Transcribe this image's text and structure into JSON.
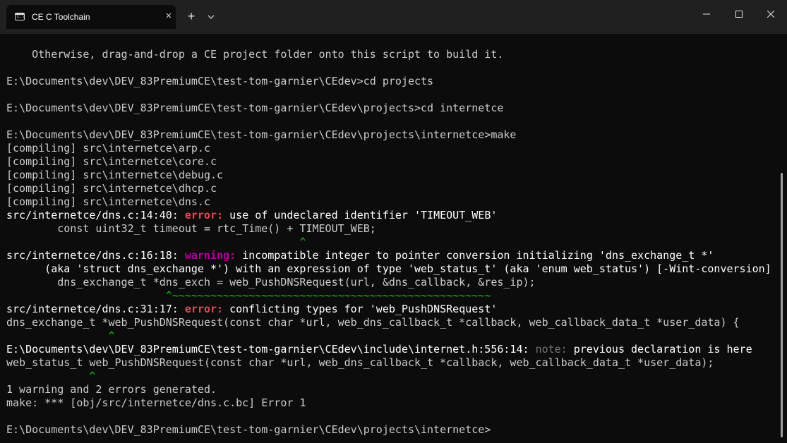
{
  "window": {
    "tab_title": "CE C Toolchain",
    "close_tab_glyph": "×",
    "new_tab_glyph": "+",
    "icons": [
      "terminal-icon",
      "close-icon",
      "plus-icon",
      "chevron-down-icon",
      "minimize-icon",
      "maximize-icon",
      "window-close-icon"
    ]
  },
  "colors": {
    "background": "#0c0c0c",
    "titlebar": "#202020",
    "text": "#cccccc",
    "error": "#e74856",
    "warning": "#b4009e",
    "note": "#767676",
    "caret": "#16c60c"
  },
  "terminal": {
    "l1": "    Otherwise, drag-and-drop a CE project folder onto this script to build it.",
    "l2": "E:\\Documents\\dev\\DEV_83PremiumCE\\test-tom-garnier\\CEdev>cd projects",
    "l3": "E:\\Documents\\dev\\DEV_83PremiumCE\\test-tom-garnier\\CEdev\\projects>cd internetce",
    "l4": "E:\\Documents\\dev\\DEV_83PremiumCE\\test-tom-garnier\\CEdev\\projects\\internetce>make",
    "c1": "[compiling] src\\internetce\\arp.c",
    "c2": "[compiling] src\\internetce\\core.c",
    "c3": "[compiling] src\\internetce\\debug.c",
    "c4": "[compiling] src\\internetce\\dhcp.c",
    "c5": "[compiling] src\\internetce\\dns.c",
    "e1_loc": "src/internetce/dns.c:14:40: ",
    "e1_kind": "error:",
    "e1_msg": " use of undeclared identifier 'TIMEOUT_WEB'",
    "e1_code": "        const uint32_t timeout = rtc_Time() + TIMEOUT_WEB;",
    "e1_caret": "                                              ^",
    "w1_loc": "src/internetce/dns.c:16:18: ",
    "w1_kind": "warning:",
    "w1_msg": " incompatible integer to pointer conversion initializing 'dns_exchange_t *'",
    "w1_msg2": "      (aka 'struct dns_exchange *') with an expression of type 'web_status_t' (aka 'enum web_status') [-Wint-conversion]",
    "w1_code": "        dns_exchange_t *dns_exch = web_PushDNSRequest(url, &dns_callback, &res_ip);",
    "w1_caret_pos": "                         ^",
    "w1_caret_tilde": "~~~~~~~~~~~~~~~~~~~~~~~~~~~~~~~~~~~~~~~~~~~~~~~~~~",
    "e2_loc": "src/internetce/dns.c:31:17: ",
    "e2_kind": "error:",
    "e2_msg": " conflicting types for 'web_PushDNSRequest'",
    "e2_code": "dns_exchange_t *web_PushDNSRequest(const char *url, web_dns_callback_t *callback, web_callback_data_t *user_data) {",
    "e2_caret": "                ^",
    "n1_loc": "E:\\Documents\\dev\\DEV_83PremiumCE\\test-tom-garnier\\CEdev\\include\\internet.h:556:14: ",
    "n1_kind": "note:",
    "n1_msg": " previous declaration is here",
    "n1_code": "web_status_t web_PushDNSRequest(const char *url, web_dns_callback_t *callback, web_callback_data_t *user_data);",
    "n1_caret": "             ^",
    "summary": "1 warning and 2 errors generated.",
    "make_err": "make: *** [obj/src/internetce/dns.c.bc] Error 1",
    "prompt": "E:\\Documents\\dev\\DEV_83PremiumCE\\test-tom-garnier\\CEdev\\projects\\internetce>"
  }
}
